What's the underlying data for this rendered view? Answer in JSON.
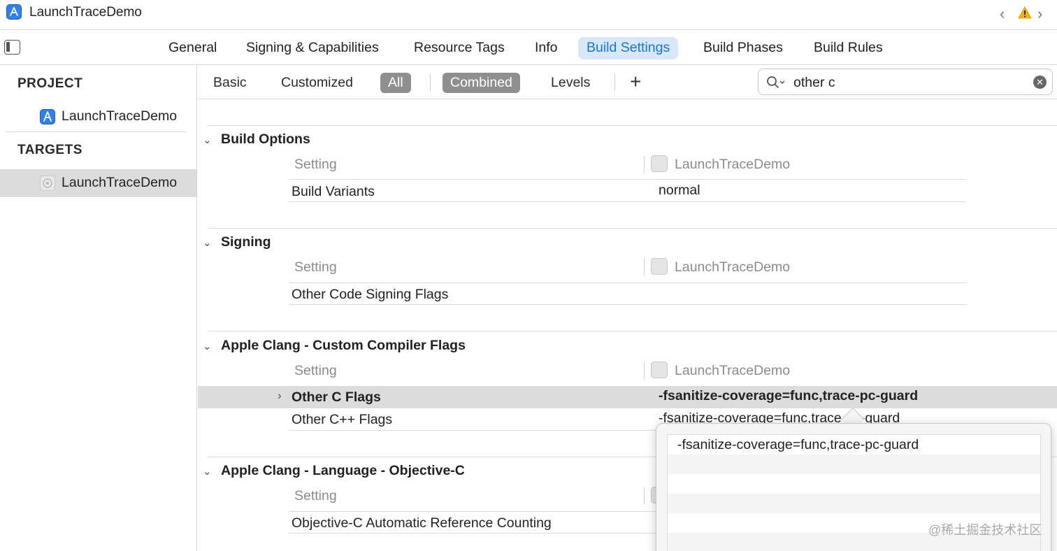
{
  "window": {
    "title": "LaunchTraceDemo"
  },
  "tabs": [
    {
      "label": "General"
    },
    {
      "label": "Signing & Capabilities"
    },
    {
      "label": "Resource Tags"
    },
    {
      "label": "Info"
    },
    {
      "label": "Build Settings",
      "active": true
    },
    {
      "label": "Build Phases"
    },
    {
      "label": "Build Rules"
    }
  ],
  "sidebar": {
    "project_header": "PROJECT",
    "project_item": "LaunchTraceDemo",
    "targets_header": "TARGETS",
    "target_item": "LaunchTraceDemo"
  },
  "filter": {
    "basic": "Basic",
    "customized": "Customized",
    "all": "All",
    "combined": "Combined",
    "levels": "Levels",
    "add": "+"
  },
  "search": {
    "value": "other c"
  },
  "sections": [
    {
      "title": "Build Options",
      "col_setting": "Setting",
      "col_target": "LaunchTraceDemo",
      "rows": [
        {
          "name": "Build Variants",
          "value": "normal"
        }
      ]
    },
    {
      "title": "Signing",
      "col_setting": "Setting",
      "col_target": "LaunchTraceDemo",
      "rows": [
        {
          "name": "Other Code Signing Flags",
          "value": ""
        }
      ]
    },
    {
      "title": "Apple Clang - Custom Compiler Flags",
      "col_setting": "Setting",
      "col_target": "LaunchTraceDemo",
      "rows": [
        {
          "name": "Other C Flags",
          "value": "-fsanitize-coverage=func,trace-pc-guard"
        },
        {
          "name": "Other C++ Flags",
          "value": "-fsanitize-coverage=func,trace-pc-guard"
        }
      ]
    },
    {
      "title": "Apple Clang - Language - Objective-C",
      "col_setting": "Setting",
      "rows": [
        {
          "name": "Objective-C Automatic Reference Counting"
        }
      ]
    }
  ],
  "popover": {
    "items": [
      "-fsanitize-coverage=func,trace-pc-guard"
    ]
  },
  "watermark": "@稀土掘金技术社区",
  "colors": {
    "accent": "#1a73e8",
    "tab_active_bg": "#d7e8fb",
    "selected_row": "#dcdcdc",
    "warning": "#f5b400"
  }
}
